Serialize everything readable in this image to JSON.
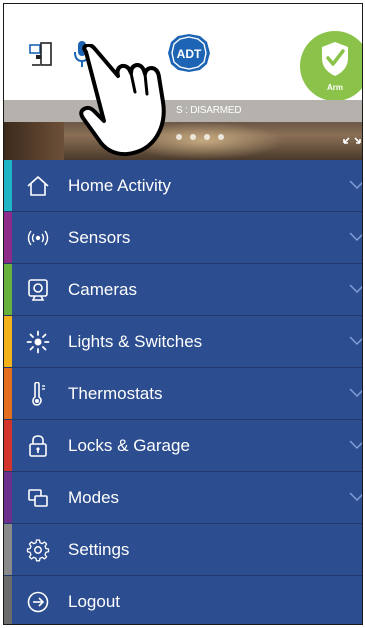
{
  "header": {
    "logo_text": "ADT",
    "arm_label": "Arm"
  },
  "banner": {
    "status_text": "S : DISARMED",
    "slide_count": 4
  },
  "menu": {
    "items": [
      {
        "label": "Home Activity",
        "icon": "home-icon",
        "accent": "#1fb5c7",
        "chevron": true
      },
      {
        "label": "Sensors",
        "icon": "sensor-icon",
        "accent": "#8e2a8a",
        "chevron": true
      },
      {
        "label": "Cameras",
        "icon": "camera-icon",
        "accent": "#69b13d",
        "chevron": true
      },
      {
        "label": "Lights & Switches",
        "icon": "light-icon",
        "accent": "#f3b21a",
        "chevron": true
      },
      {
        "label": "Thermostats",
        "icon": "thermostat-icon",
        "accent": "#e36f1f",
        "chevron": true
      },
      {
        "label": "Locks & Garage",
        "icon": "lock-icon",
        "accent": "#d3342c",
        "chevron": true
      },
      {
        "label": "Modes",
        "icon": "modes-icon",
        "accent": "#6c2f8d",
        "chevron": true
      },
      {
        "label": "Settings",
        "icon": "gear-icon",
        "accent": "#8a8a8a",
        "chevron": false
      },
      {
        "label": "Logout",
        "icon": "logout-icon",
        "accent": "#6b6b6b",
        "chevron": false
      }
    ]
  },
  "colors": {
    "menu_bg": "#2c4d8f",
    "arm_green": "#8bc34a",
    "adt_blue": "#1d64b5"
  }
}
